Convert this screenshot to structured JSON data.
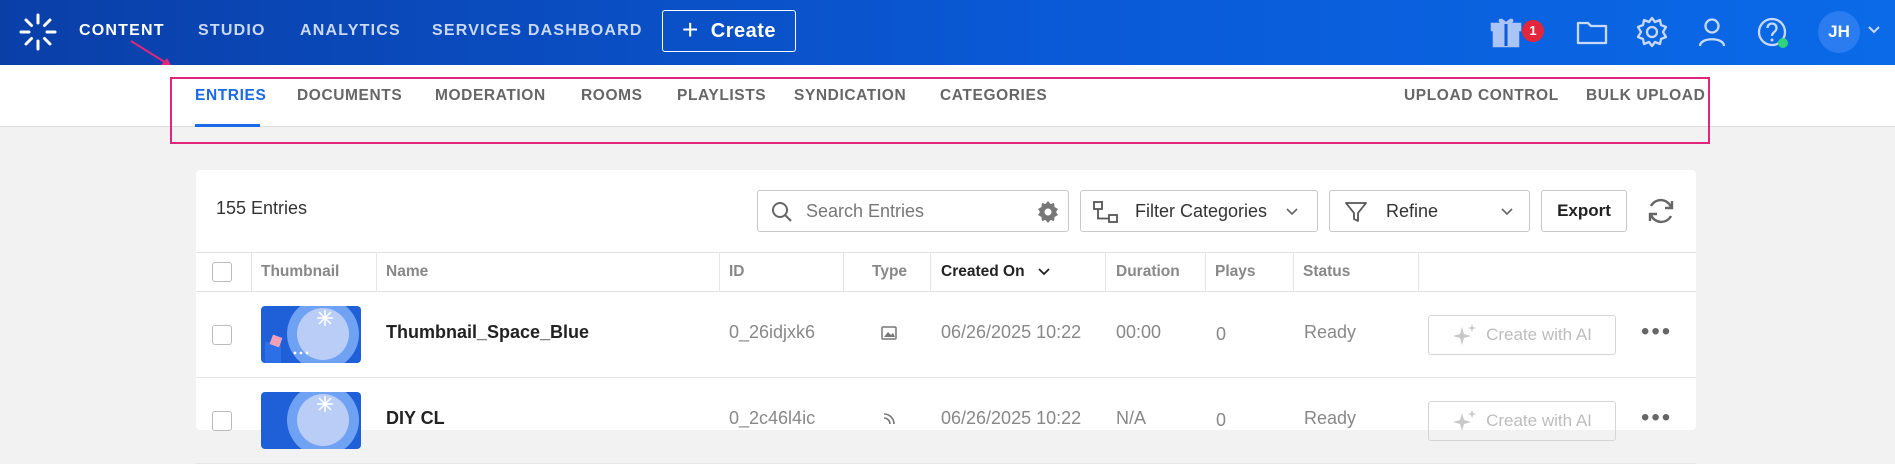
{
  "topnav": {
    "items": [
      "CONTENT",
      "STUDIO",
      "ANALYTICS",
      "SERVICES DASHBOARD"
    ],
    "create_label": "Create",
    "notification_count": "1",
    "avatar_initials": "JH"
  },
  "subnav": {
    "items": [
      "ENTRIES",
      "DOCUMENTS",
      "MODERATION",
      "ROOMS",
      "PLAYLISTS",
      "SYNDICATION",
      "CATEGORIES"
    ],
    "right_items": [
      "UPLOAD CONTROL",
      "BULK UPLOAD"
    ]
  },
  "toolbar": {
    "count": "155 Entries",
    "search_placeholder": "Search Entries",
    "filter_categories": "Filter Categories",
    "refine": "Refine",
    "export": "Export"
  },
  "table": {
    "headers": [
      "Thumbnail",
      "Name",
      "ID",
      "Type",
      "Created On",
      "Duration",
      "Plays",
      "Status"
    ],
    "rows": [
      {
        "name": "Thumbnail_Space_Blue",
        "id": "0_26idjxk6",
        "created": "06/26/2025 10:22",
        "duration": "00:00",
        "plays": "0",
        "status": "Ready",
        "action": "Create with AI"
      },
      {
        "name": "DIY CL",
        "id": "0_2c46l4ic",
        "created": "06/26/2025 10:22",
        "duration": "N/A",
        "plays": "0",
        "status": "Ready",
        "action": "Create with AI"
      }
    ]
  },
  "colors": {
    "topbar": "#0a59d6",
    "accent": "#1a6ae6",
    "highlight": "#e0267a",
    "badge": "#e3263c"
  }
}
